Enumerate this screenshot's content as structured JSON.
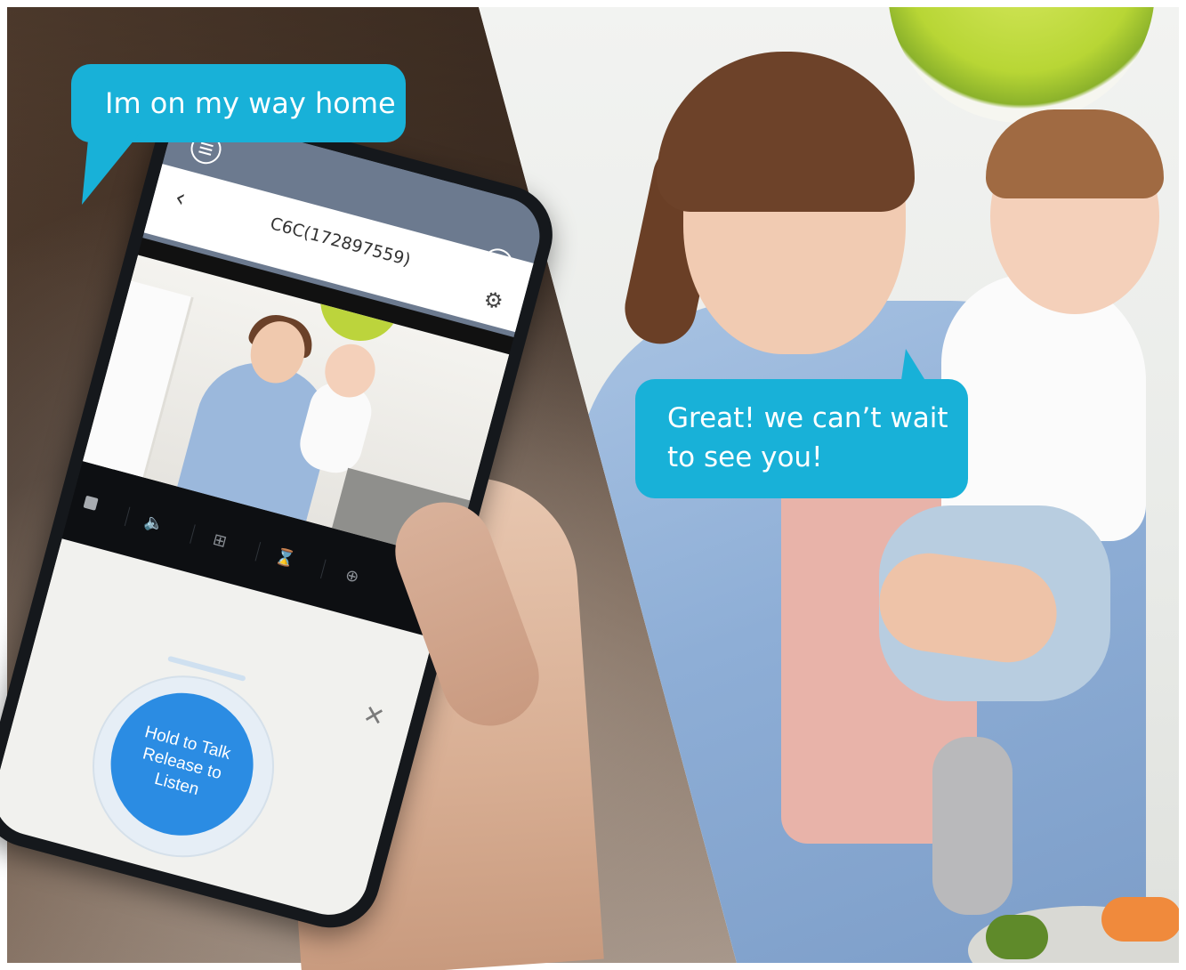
{
  "bubbles": {
    "left": "Im on my way home",
    "right_line1": "Great! we can’t wait",
    "right_line2": "to see you!"
  },
  "app": {
    "camera_title": "C6C(172897559)",
    "talk_button_lines": [
      "Hold to Talk",
      "Release to",
      "Listen"
    ]
  },
  "icons": {
    "menu": "menu-icon",
    "back": "back-arrow-icon",
    "next": "chevron-right-circle-icon",
    "settings": "gear-icon",
    "stop": "stop-icon",
    "speaker": "speaker-icon",
    "layout": "grid-layout-icon",
    "flip": "flip-icon",
    "zoom": "zoom-in-icon",
    "close": "close-icon"
  },
  "colors": {
    "bubble": "#18b1d8",
    "talk_button": "#2b8ce3",
    "app_header": "#6c7a8f"
  }
}
